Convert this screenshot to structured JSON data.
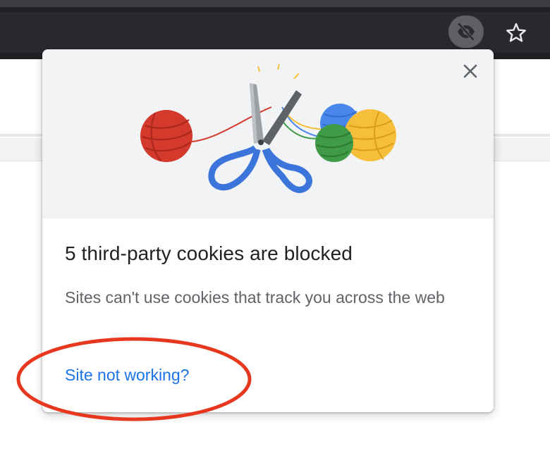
{
  "toolbar": {
    "tracking_icon": "eye-off-icon",
    "bookmark_icon": "star-icon"
  },
  "bubble": {
    "close_icon": "close-icon",
    "title": "5 third-party cookies are blocked",
    "description": "Sites can't use cookies that track you across the web",
    "link": "Site not working?"
  },
  "colors": {
    "link": "#1a73e8",
    "annotation_circle": "#e8371f",
    "yarn_red": "#d33a2c",
    "yarn_blue": "#4a87ec",
    "yarn_green": "#3f9b48",
    "yarn_yellow": "#f5bf3c",
    "scissors_handle": "#3b74db"
  }
}
